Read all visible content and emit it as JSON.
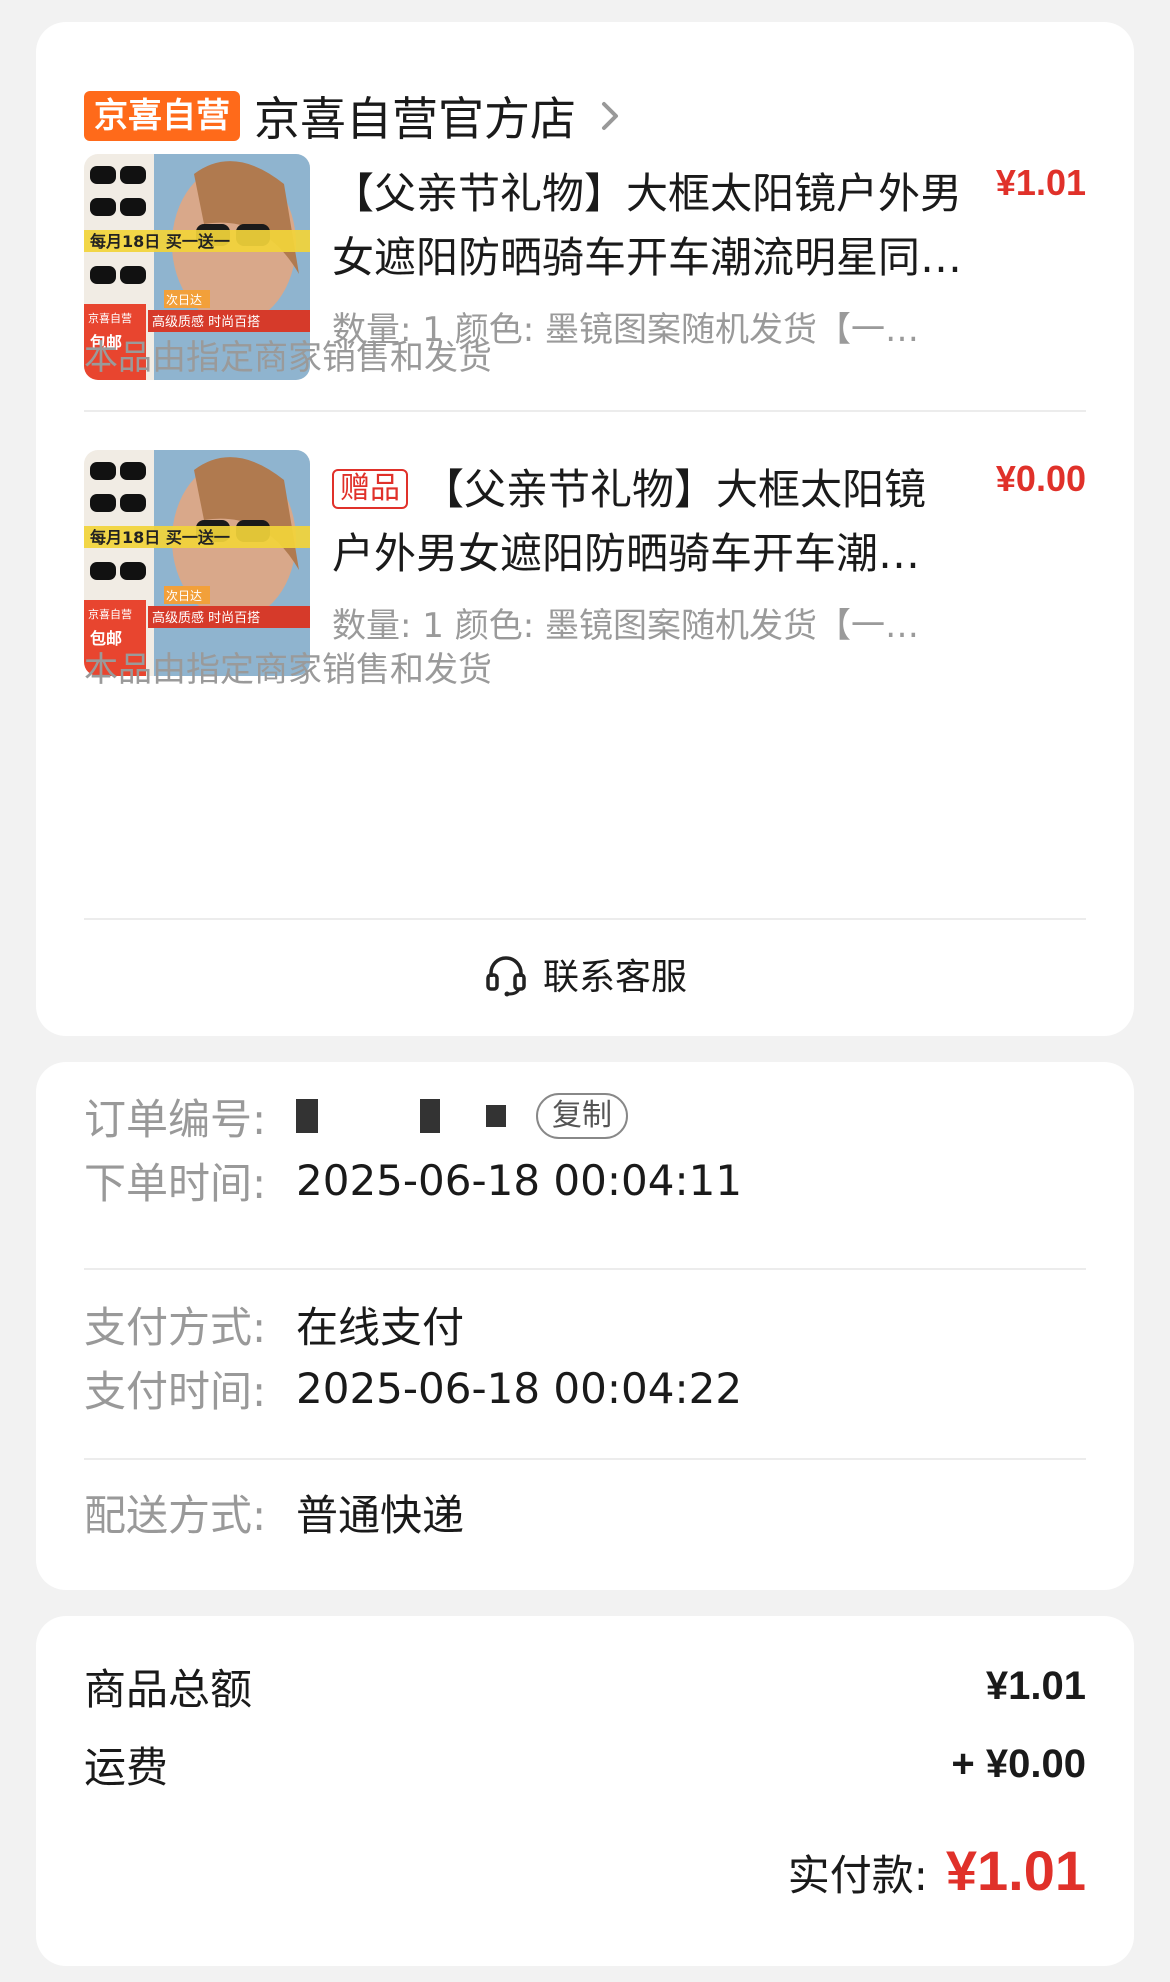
{
  "store": {
    "badge": "京喜自营",
    "name": "京喜自营官方店"
  },
  "products": [
    {
      "gift_tag": "",
      "title": "【父亲节礼物】大框太阳镜户外男女遮阳防晒骑车开车潮流明星同…",
      "price": "¥1.01",
      "spec": "数量: 1 颜色: 墨镜图案随机发货【一…",
      "seller_note": "本品由指定商家销售和发货",
      "thumb_text": {
        "promo": "每月18日 买一送一",
        "tag1": "京喜自营",
        "tag2": "包邮",
        "tag3": "次日达",
        "tag4": "高级质感 时尚百搭"
      }
    },
    {
      "gift_tag": "赠品",
      "title": "【父亲节礼物】大框太阳镜户外男女遮阳防晒骑车开车潮…",
      "price": "¥0.00",
      "spec": "数量: 1 颜色: 墨镜图案随机发货【一…",
      "seller_note": "本品由指定商家销售和发货",
      "thumb_text": {
        "promo": "每月18日 买一送一",
        "tag1": "京喜自营",
        "tag2": "包邮",
        "tag3": "次日达",
        "tag4": "高级质感 时尚百搭"
      }
    }
  ],
  "service": {
    "label": "联系客服",
    "icon": "headset-icon"
  },
  "order_info": {
    "order_no_label": "订单编号:",
    "copy_label": "复制",
    "order_time_label": "下单时间:",
    "order_time": "2025-06-18 00:04:11",
    "pay_method_label": "支付方式:",
    "pay_method": "在线支付",
    "pay_time_label": "支付时间:",
    "pay_time": "2025-06-18 00:04:22",
    "delivery_label": "配送方式:",
    "delivery": "普通快递"
  },
  "amounts": {
    "goods_total_label": "商品总额",
    "goods_total": "¥1.01",
    "shipping_label": "运费",
    "shipping": "+ ¥0.00",
    "paid_label": "实付款:",
    "paid": "¥1.01"
  },
  "colors": {
    "accent_red": "#e0312a",
    "badge_orange": "#ff6a1a",
    "background": "#f2f2f2"
  }
}
